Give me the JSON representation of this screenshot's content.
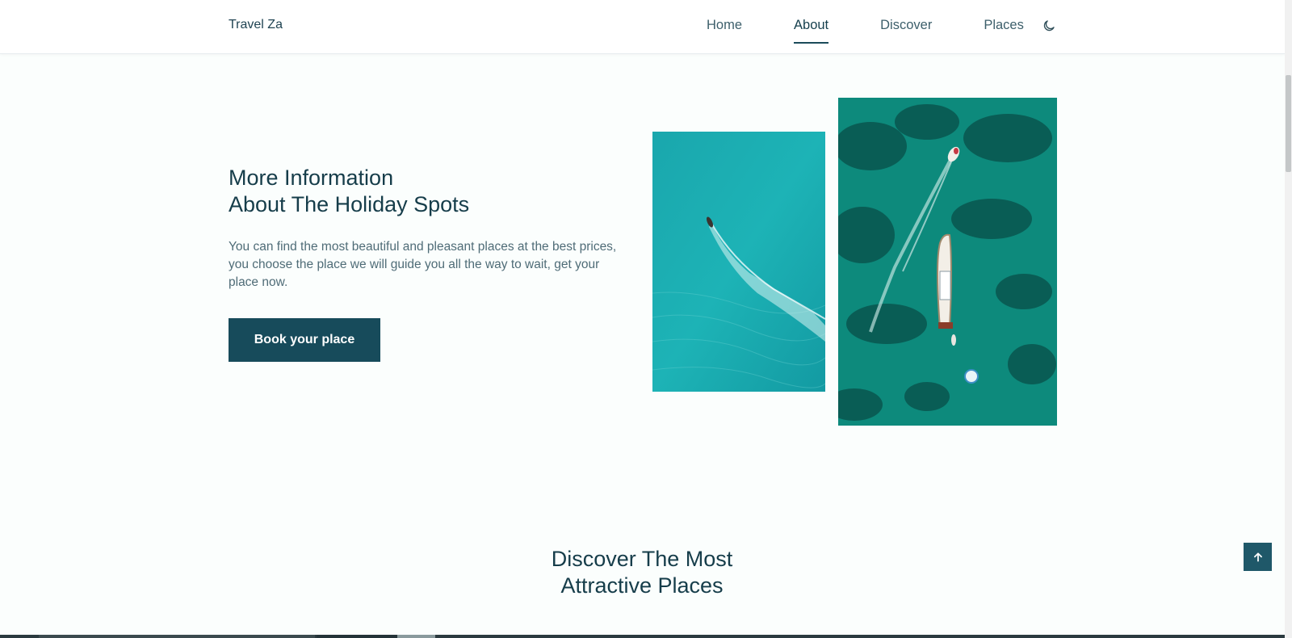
{
  "header": {
    "brand": "Travel Za",
    "nav": [
      {
        "label": "Home"
      },
      {
        "label": "About"
      },
      {
        "label": "Discover"
      },
      {
        "label": "Places"
      }
    ],
    "active_item": "About",
    "theme_toggle_icon": "moon-icon"
  },
  "about": {
    "title_line1": "More Information",
    "title_line2": "About The Holiday Spots",
    "description": "You can find the most beautiful and pleasant places at the best prices, you choose the place we will guide you all the way to wait, get your place now.",
    "button_label": "Book your place",
    "images": [
      {
        "name": "boat-wake-turquoise-image"
      },
      {
        "name": "yacht-aerial-image"
      }
    ]
  },
  "discover": {
    "title_line1": "Discover The Most",
    "title_line2": "Attractive Places"
  },
  "scroll_up_icon": "arrow-up-icon",
  "colors": {
    "primary": "#174b5b",
    "heading": "#163d4a",
    "text": "#4f6c77",
    "background": "#fbfefd"
  }
}
